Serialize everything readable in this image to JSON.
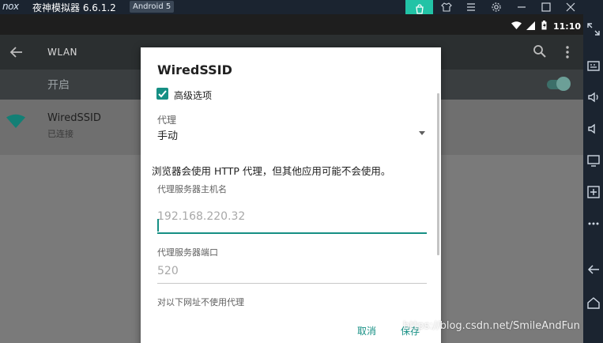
{
  "emulator": {
    "logo": "nox",
    "title": "夜神模拟器 6.6.1.2",
    "android_badge": "Android 5",
    "toolbar_icons": [
      "store-icon",
      "shirt-icon",
      "menu-icon",
      "gear-icon",
      "minimize-icon",
      "maximize-icon",
      "close-icon"
    ],
    "sidebar_icons": [
      "expand-icon",
      "keyboard-icon",
      "volume-up-icon",
      "volume-down-icon",
      "screen-icon",
      "add-apk-icon",
      "more-icon",
      "back-icon",
      "home-icon"
    ],
    "accent": "#22c3a6"
  },
  "statusbar": {
    "time": "11:10"
  },
  "appbar": {
    "title": "WLAN"
  },
  "switchbar": {
    "label": "开启"
  },
  "network": {
    "name": "WiredSSID",
    "status": "已连接"
  },
  "dialog": {
    "title": "WiredSSID",
    "advanced_label": "高级选项",
    "advanced_checked": true,
    "proxy_label": "代理",
    "proxy_value": "手动",
    "note": "浏览器会使用 HTTP 代理，但其他应用可能不会使用。",
    "host_label": "代理服务器主机名",
    "host_placeholder": "192.168.220.32",
    "port_label": "代理服务器端口",
    "port_placeholder": "520",
    "bypass_label": "对以下网址不使用代理",
    "cancel_label": "取消",
    "save_label": "保存",
    "accent": "#168f84"
  },
  "watermark": "https://blog.csdn.net/SmileAndFun"
}
